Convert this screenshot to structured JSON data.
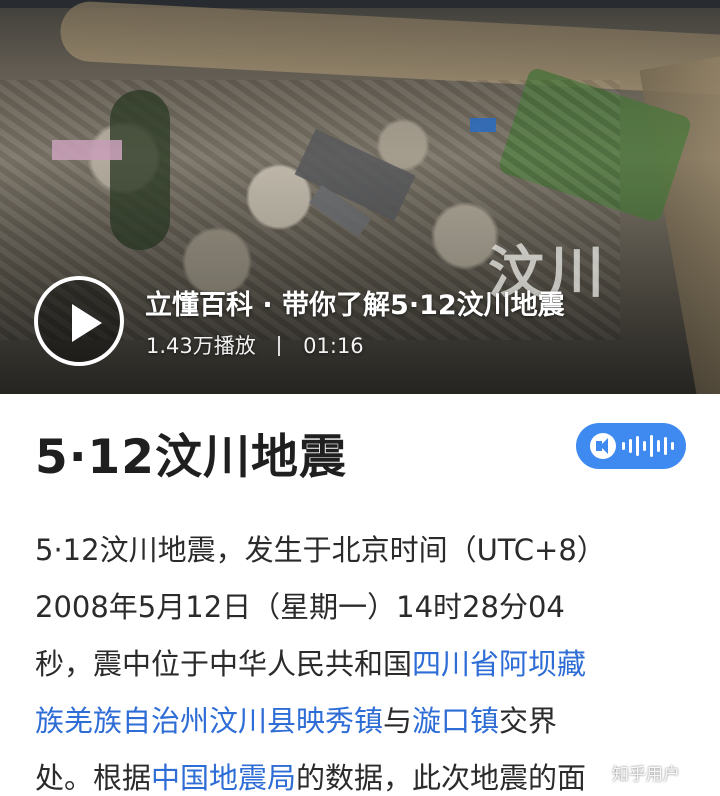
{
  "video": {
    "overlay_text": "汶川",
    "title": "立懂百科 · 带你了解5·12汶川地震",
    "plays": "1.43万播放",
    "duration": "01:16",
    "play_icon": "play-icon"
  },
  "article": {
    "title": "5·12汶川地震",
    "audio_icon": "speaker-icon",
    "lines": {
      "l1": "5·12汶川地震，发生于北京时间（UTC+8）",
      "l2": "2008年5月12日（星期一）14时28分04",
      "l3a": "秒，震中位于中华人民共和国",
      "l3b": "四川省阿坝藏",
      "l4a": "族羌族自治州汶川县映秀镇",
      "l4b": "与",
      "l4c": "漩口镇",
      "l4d": "交界",
      "l5a": "处。根据",
      "l5b": "中国地震局",
      "l5c": "的数据，此次地震的面"
    }
  },
  "watermark": "知乎用户",
  "colors": {
    "link": "#2f6dd6",
    "audio_pill": "#3f8af0",
    "title_text": "#1f1f1f",
    "body_text": "#2b2b2b"
  }
}
